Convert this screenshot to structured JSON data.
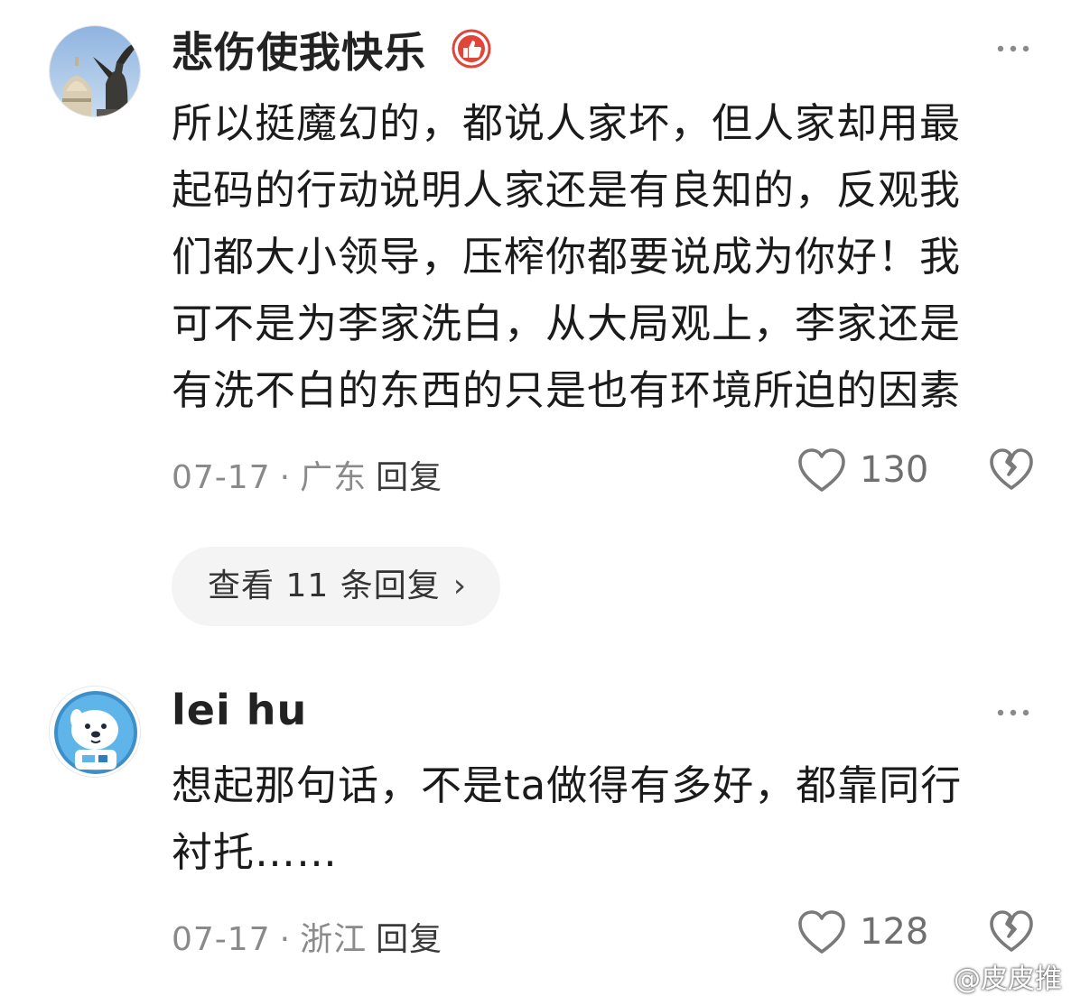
{
  "comments": [
    {
      "username": "悲伤使我快乐",
      "badge_icon": "like-badge-icon",
      "avatar_icon": "statue-avatar",
      "lines": [
        "所以挺魔幻的，都说人家坏，但人家却用最",
        "起码的行动说明人家还是有良知的，反观我",
        "们都大小领导，压榨你都要说成为你好！我",
        "可不是为李家洗白，从大局观上，李家还是",
        "有洗不白的东西的只是也有环境所迫的因素"
      ],
      "date": "07-17",
      "separator": "·",
      "location": "广东",
      "reply_label": "回复",
      "like_count": "130",
      "view_replies": "查看 11 条回复",
      "view_replies_chevron": "›"
    },
    {
      "username": "lei hu",
      "avatar_icon": "dog-astronaut-avatar",
      "lines": [
        "想起那句话，不是ta做得有多好，都靠同行",
        "衬托……"
      ],
      "date": "07-17",
      "separator": "·",
      "location": "浙江",
      "reply_label": "回复",
      "like_count": "128"
    }
  ],
  "watermark": {
    "text": "@皮皮推"
  },
  "colors": {
    "accent_badge": "#e0453a",
    "meta_gray": "#8a8a8a",
    "pill_bg": "#f4f4f4"
  }
}
